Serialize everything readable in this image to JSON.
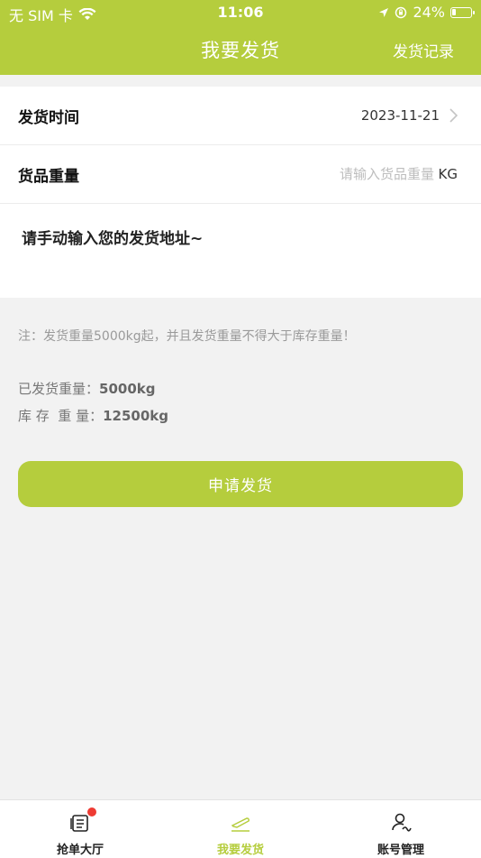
{
  "status_bar": {
    "carrier": "无 SIM 卡",
    "time": "11:06",
    "battery": "24%",
    "battery_level": 0.24
  },
  "header": {
    "title": "我要发货",
    "right_link": "发货记录"
  },
  "form": {
    "date_label": "发货时间",
    "date_value": "2023-11-21",
    "weight_label": "货品重量",
    "weight_placeholder": "请输入货品重量",
    "weight_unit": "KG",
    "address_text": "请手动输入您的发货地址~"
  },
  "info": {
    "note": "注：发货重量5000kg起，并且发货重量不得大于库存重量！",
    "shipped_label": "已发货重量：",
    "shipped_value": "5000kg",
    "stock_label": "库 存  重 量：",
    "stock_value": "12500kg"
  },
  "submit_label": "申请发货",
  "tabs": [
    {
      "label": "抢单大厅",
      "icon": "list-icon",
      "badge": true
    },
    {
      "label": "我要发货",
      "icon": "plane-icon",
      "active": true
    },
    {
      "label": "账号管理",
      "icon": "user-icon"
    }
  ],
  "colors": {
    "accent": "#b5cd3d",
    "badge": "#ee3b33"
  }
}
